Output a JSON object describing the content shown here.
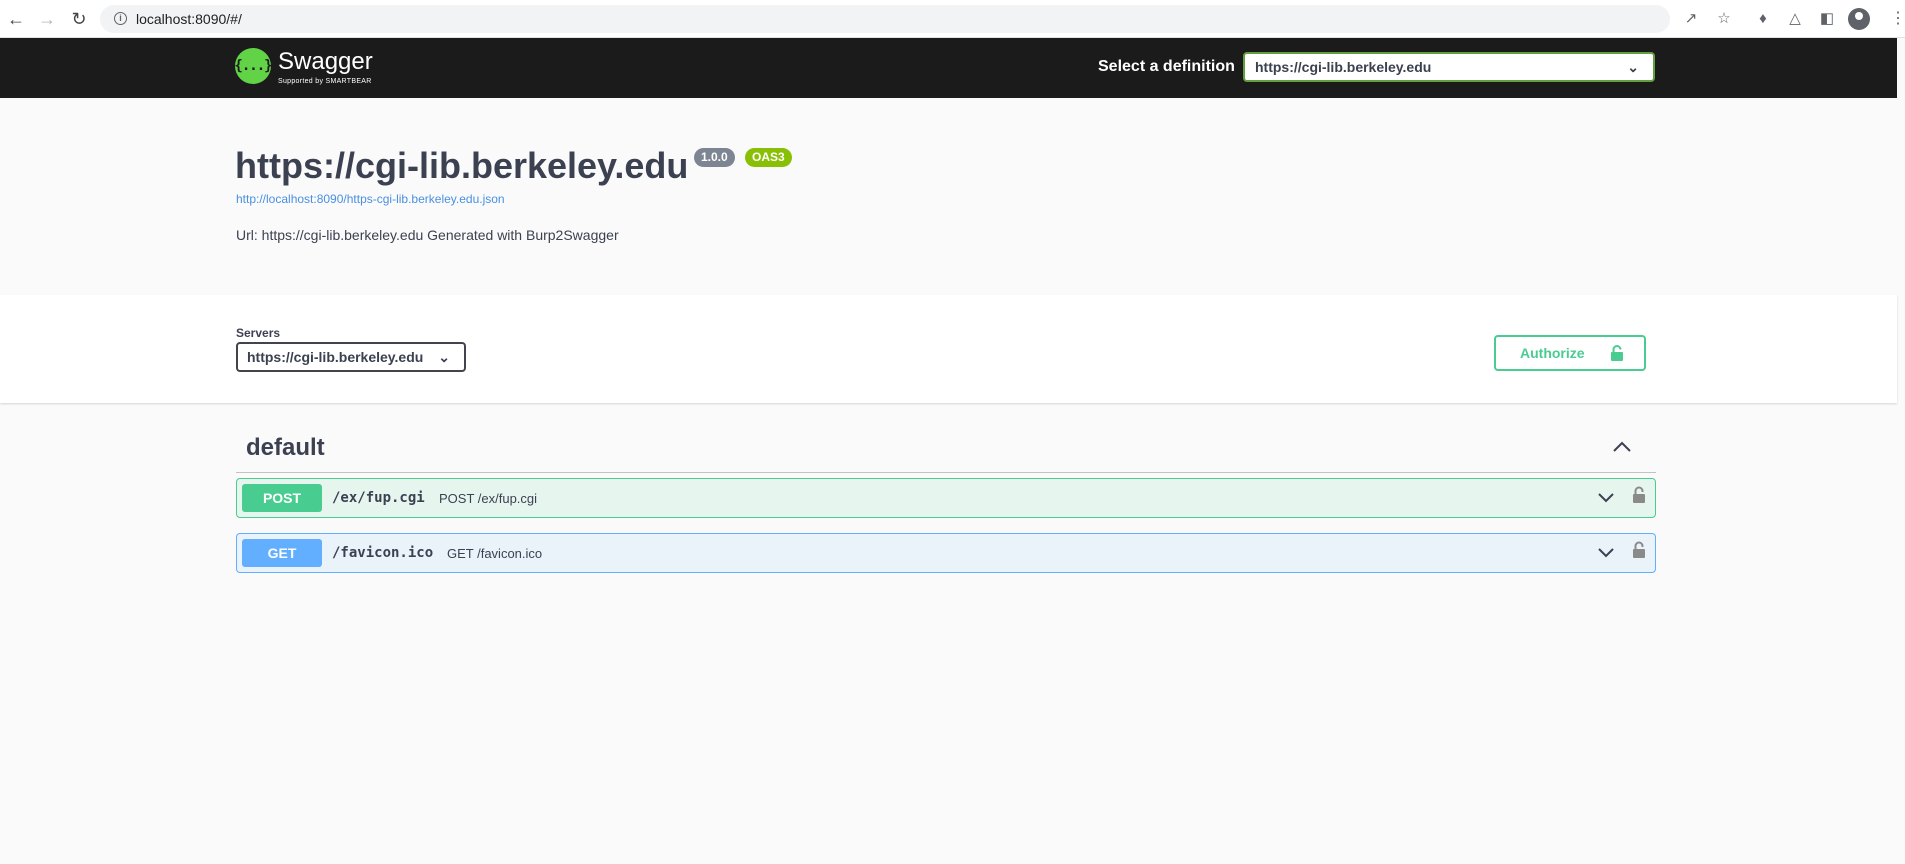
{
  "browser": {
    "url": "localhost:8090/#/"
  },
  "topbar": {
    "brand": "Swagger",
    "sub_brand": "Supported by SMARTBEAR",
    "logo_glyph": "{...}",
    "definition_label": "Select a definition",
    "definition_value": "https://cgi-lib.berkeley.edu"
  },
  "info": {
    "title": "https://cgi-lib.berkeley.edu",
    "version_badge": "1.0.0",
    "oas_badge": "OAS3",
    "spec_link": "http://localhost:8090/https-cgi-lib.berkeley.edu.json",
    "description": "Url: https://cgi-lib.berkeley.edu Generated with Burp2Swagger"
  },
  "servers": {
    "label": "Servers",
    "selected": "https://cgi-lib.berkeley.edu",
    "authorize_label": "Authorize"
  },
  "tag": {
    "name": "default",
    "operations": [
      {
        "method": "POST",
        "path": "/ex/fup.cgi",
        "summary": "POST /ex/fup.cgi"
      },
      {
        "method": "GET",
        "path": "/favicon.ico",
        "summary": "GET /favicon.ico"
      }
    ]
  },
  "colors": {
    "topbar_bg": "#1b1b1b",
    "swagger_green": "#62d346",
    "post_color": "#49cc90",
    "get_color": "#61affe",
    "version_badge": "#7d8492",
    "oas_badge": "#89bf04",
    "link": "#4990e2"
  },
  "icons": {
    "back": "arrow-left-icon",
    "forward": "arrow-right-icon",
    "reload": "reload-icon",
    "info": "info-icon",
    "share": "share-icon",
    "bookmark": "star-icon",
    "extensions": "puzzle-icon",
    "labs": "flask-icon",
    "sidepanel": "sidepanel-icon",
    "profile": "avatar-icon",
    "menu": "kebab-menu-icon",
    "lock": "lock-icon",
    "chevron": "chevron-icon"
  }
}
